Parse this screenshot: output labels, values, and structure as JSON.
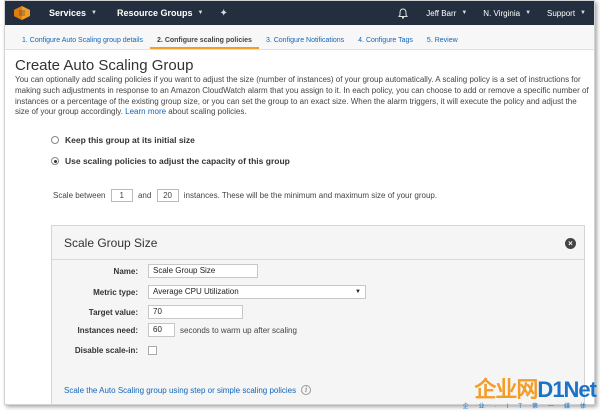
{
  "nav": {
    "services": "Services",
    "resource_groups": "Resource Groups",
    "pin_icon": "pin-icon",
    "user": "Jeff Barr",
    "region": "N. Virginia",
    "support": "Support",
    "brand_color": "#232f3e",
    "accent": "#f39c26"
  },
  "steps": [
    {
      "label": "1. Configure Auto Scaling group details"
    },
    {
      "label": "2. Configure scaling policies"
    },
    {
      "label": "3. Configure Notifications"
    },
    {
      "label": "4. Configure Tags"
    },
    {
      "label": "5. Review"
    }
  ],
  "page": {
    "title": "Create Auto Scaling Group",
    "description": "You can optionally add scaling policies if you want to adjust the size (number of instances) of your group automatically. A scaling policy is a set of instructions for making such adjustments in response to an Amazon CloudWatch alarm that you assign to it. In each policy, you can choose to add or remove a specific number of instances or a percentage of the existing group size, or you can set the group to an exact size. When the alarm triggers, it will execute the policy and adjust the size of your group accordingly.",
    "learn_more": "Learn more",
    "learn_more_suffix": "about scaling policies."
  },
  "options": {
    "keep_initial": "Keep this group at its initial size",
    "use_policies": "Use scaling policies to adjust the capacity of this group"
  },
  "scale_between": {
    "prefix": "Scale between",
    "min": "1",
    "and": "and",
    "max": "20",
    "suffix": "instances. These will be the minimum and maximum size of your group."
  },
  "scale_group": {
    "title": "Scale Group Size",
    "name_label": "Name:",
    "name_value": "Scale Group Size",
    "metric_label": "Metric type:",
    "metric_value": "Average CPU Utilization",
    "target_label": "Target value:",
    "target_value": "70",
    "warmup_label": "Instances need:",
    "warmup_value": "60",
    "warmup_suffix": "seconds to warm up after scaling",
    "disable_label": "Disable scale-in:",
    "step_link": "Scale the Auto Scaling group using step or simple scaling policies"
  },
  "watermark": {
    "main": "企业网",
    "brand_d": "D",
    "brand_rest": "1Net",
    "sub": "企业·IT第一媒体"
  }
}
